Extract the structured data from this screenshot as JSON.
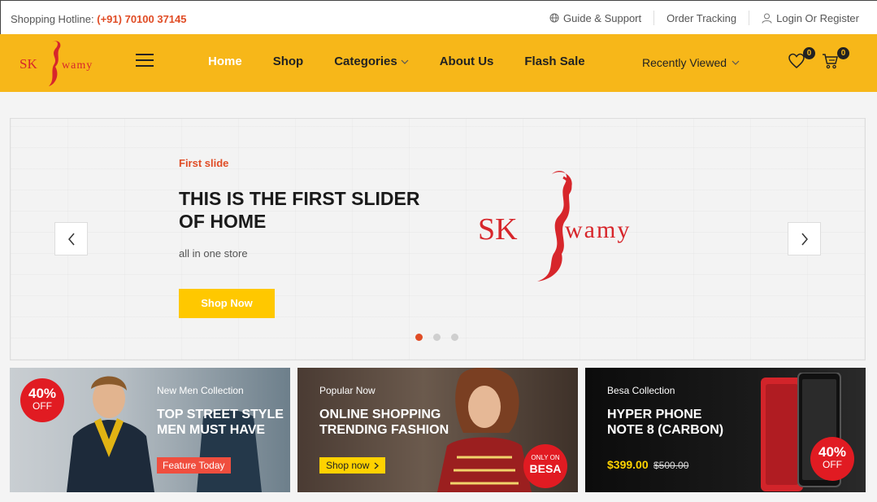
{
  "topbar": {
    "hotline_label": "Shopping Hotline:",
    "hotline_number": "(+91) 70100 37145",
    "links": [
      {
        "label": "Guide & Support",
        "icon": "globe-icon"
      },
      {
        "label": "Order Tracking",
        "icon": ""
      },
      {
        "label": "Login Or Register",
        "icon": "user-icon"
      }
    ]
  },
  "header": {
    "logo_text_left": "SK",
    "logo_text_right": "wamy",
    "nav": [
      {
        "label": "Home",
        "active": true
      },
      {
        "label": "Shop"
      },
      {
        "label": "Categories",
        "dropdown": true
      },
      {
        "label": "About Us"
      },
      {
        "label": "Flash Sale"
      }
    ],
    "recently_viewed": "Recently Viewed",
    "wishlist_count": "0",
    "cart_count": "0"
  },
  "slider": {
    "subtitle": "First slide",
    "title": "THIS IS THE FIRST SLIDER OF HOME",
    "description": "all in one store",
    "button": "Shop Now",
    "logo_text_left": "SK",
    "logo_text_right": "wamy",
    "slides_total": 3,
    "active_slide": 1
  },
  "banners": [
    {
      "subtitle": "New Men Collection",
      "title_line1": "TOP STREET STYLE",
      "title_line2": "MEN MUST HAVE",
      "badge_percent": "40%",
      "badge_off": "OFF",
      "tag": "Feature Today"
    },
    {
      "subtitle": "Popular Now",
      "title_line1": "ONLINE SHOPPING",
      "title_line2": "TRENDING FASHION",
      "button": "Shop now",
      "badge_small": "ONLY ON",
      "badge_big": "BESA"
    },
    {
      "subtitle": "Besa Collection",
      "title_line1": "HYPER PHONE",
      "title_line2": "NOTE 8 (CARBON)",
      "price": "$399.00",
      "old_price": "$500.00",
      "badge_percent": "40%",
      "badge_off": "OFF"
    }
  ],
  "colors": {
    "brand_yellow": "#f7b719",
    "accent_red": "#e04c25",
    "badge_red": "#e11b22"
  }
}
